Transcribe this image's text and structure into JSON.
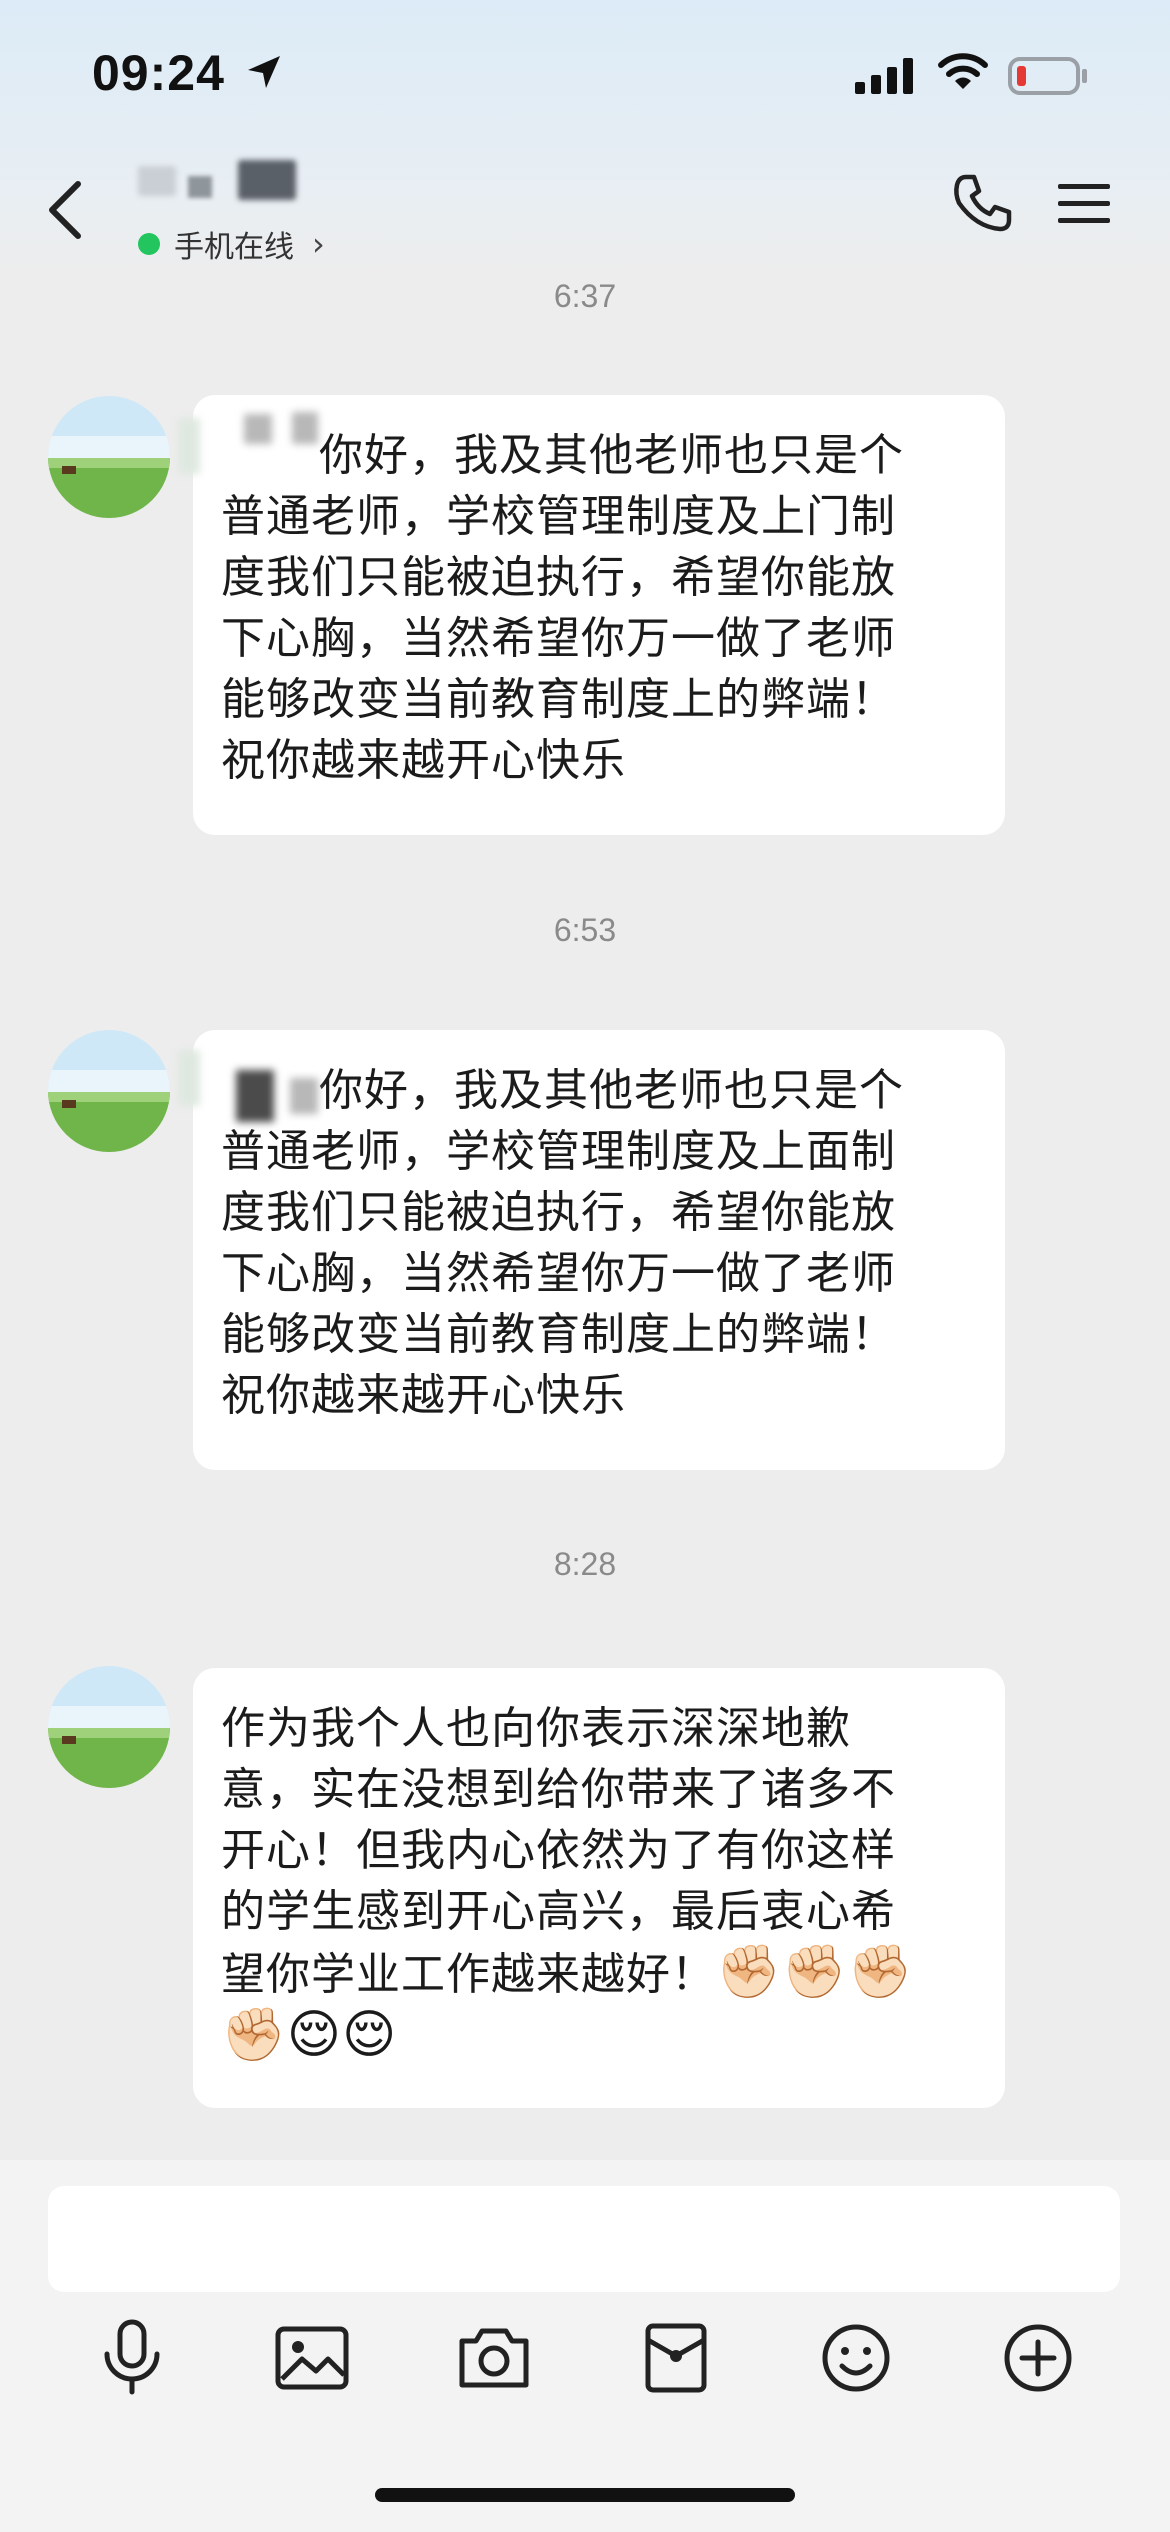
{
  "status_bar": {
    "time": "09:24"
  },
  "header": {
    "contact_name": "",
    "presence_text": "手机在线",
    "presence_color": "#22c55e"
  },
  "messages": [
    {
      "timestamp": "6:37",
      "lines": [
        "你好，我及其他老师也只是个",
        "普通老师，学校管理制度及上门制",
        "度我们只能被迫执行，希望你能放",
        "下心胸，当然希望你万一做了老师",
        "能够改变当前教育制度上的弊端！",
        "祝你越来越开心快乐"
      ]
    },
    {
      "timestamp": "6:53",
      "lines": [
        "你好，我及其他老师也只是个",
        "普通老师，学校管理制度及上面制",
        "度我们只能被迫执行，希望你能放",
        "下心胸，当然希望你万一做了老师",
        "能够改变当前教育制度上的弊端！",
        "祝你越来越开心快乐"
      ]
    },
    {
      "timestamp": "8:28",
      "lines": [
        "作为我个人也向你表示深深地歉",
        "意，实在没想到给你带来了诸多不",
        "开心！但我内心依然为了有你这样",
        "的学生感到开心高兴，最后衷心希",
        "望你学业工作越来越好！"
      ],
      "emojis": [
        "✊🏻",
        "✊🏻",
        "✊🏻",
        "✊🏻",
        "😌",
        "😌"
      ]
    }
  ],
  "input": {
    "placeholder": ""
  },
  "toolbar": {
    "icons": [
      "microphone-icon",
      "image-icon",
      "camera-icon",
      "red-packet-icon",
      "emoji-icon",
      "plus-icon"
    ]
  }
}
